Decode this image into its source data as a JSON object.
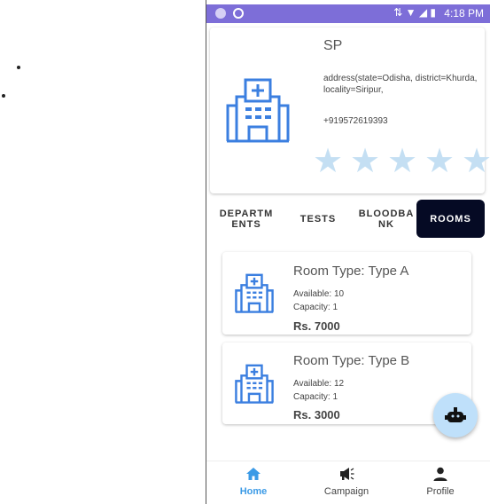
{
  "status_bar": {
    "time": "4:18 PM",
    "background": "#7d6ed8"
  },
  "hospital": {
    "name": "SP",
    "address": "address(state=Odisha, district=Khurda, locality=Siripur,",
    "phone": "+919572619393",
    "rating_stars": 5,
    "icon": "hospital-icon",
    "accent": "#3b7fe0"
  },
  "tabs": [
    {
      "label": "DEPARTM\nENTS",
      "active": false
    },
    {
      "label": "TESTS",
      "active": false
    },
    {
      "label": "BLOODBA\nNK",
      "active": false
    },
    {
      "label": "ROOMS",
      "active": true
    }
  ],
  "rooms": [
    {
      "title": "Room Type: Type A",
      "available": "Available: 10",
      "capacity": "Capacity: 1",
      "price": "Rs. 7000"
    },
    {
      "title": "Room Type: Type B",
      "available": "Available: 12",
      "capacity": "Capacity: 1",
      "price": "Rs. 3000"
    }
  ],
  "fab": {
    "icon": "chatbot-icon",
    "background": "#bfe0fa"
  },
  "bottom_nav": [
    {
      "label": "Home",
      "icon": "home-icon",
      "active": true
    },
    {
      "label": "Campaign",
      "icon": "megaphone-icon",
      "active": false
    },
    {
      "label": "Profile",
      "icon": "person-icon",
      "active": false
    }
  ]
}
